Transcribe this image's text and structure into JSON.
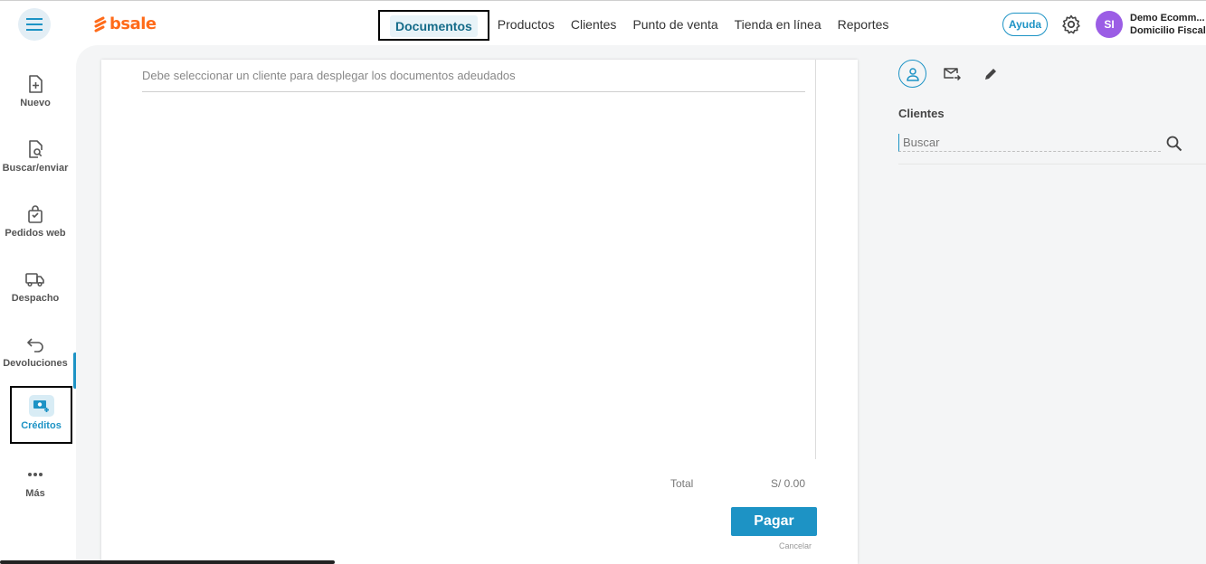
{
  "brand": {
    "name": "bsale",
    "accent": "#ff6b1a"
  },
  "nav": {
    "items": [
      {
        "label": "Documentos",
        "active": true
      },
      {
        "label": "Productos"
      },
      {
        "label": "Clientes"
      },
      {
        "label": "Punto de venta"
      },
      {
        "label": "Tienda en línea"
      },
      {
        "label": "Reportes"
      }
    ]
  },
  "header": {
    "help_label": "Ayuda",
    "avatar_initials": "SI",
    "user_name": "Demo Ecomm...",
    "user_subtitle": "Domicilio Fiscal"
  },
  "sidebar": {
    "items": [
      {
        "label": "Nuevo",
        "icon": "file-plus-icon"
      },
      {
        "label": "Buscar/enviar",
        "icon": "file-search-icon"
      },
      {
        "label": "Pedidos web",
        "icon": "shopping-bag-icon"
      },
      {
        "label": "Despacho",
        "icon": "truck-icon"
      },
      {
        "label": "Devoluciones",
        "icon": "return-arrow-icon"
      },
      {
        "label": "Créditos",
        "icon": "money-plus-icon",
        "active": true
      },
      {
        "label": "Más",
        "icon": "more-dots-icon"
      }
    ]
  },
  "document": {
    "message": "Debe seleccionar un cliente para desplegar los documentos adeudados",
    "total_label": "Total",
    "total_value": "S/ 0.00",
    "pay_label": "Pagar",
    "cancel_label": "Cancelar"
  },
  "client_panel": {
    "title": "Clientes",
    "search_placeholder": "Buscar"
  },
  "colors": {
    "primary": "#1d93c5",
    "avatar": "#9b5de5"
  }
}
